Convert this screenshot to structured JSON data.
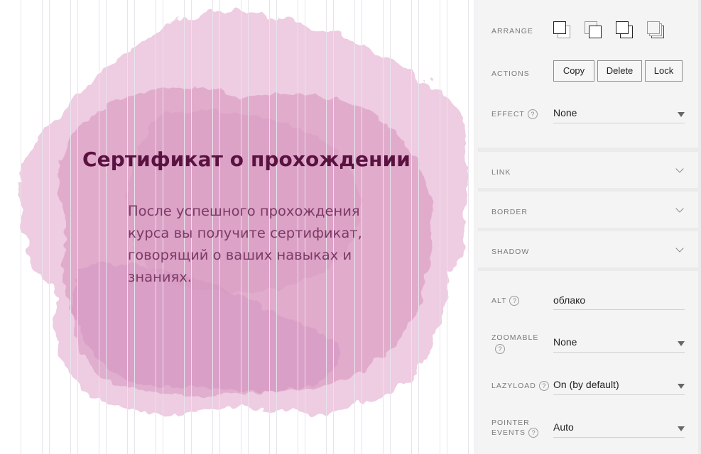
{
  "canvas": {
    "heading": "Сертификат о прохождении",
    "body_lines": [
      "После успешного прохождения",
      "курса вы получите сертификат,",
      "говорящий о ваших навыках и",
      "знаниях."
    ],
    "colors": {
      "blob": "#e2a6cc",
      "heading": "#5a1240",
      "body": "#7c3a65",
      "grid_line": "#e8e4ec"
    }
  },
  "panel": {
    "arrange": {
      "label": "ARRANGE",
      "icons": [
        "bring-to-front-icon",
        "bring-forward-icon",
        "send-backward-icon",
        "send-to-back-icon"
      ]
    },
    "actions": {
      "label": "ACTIONS",
      "buttons": [
        "Copy",
        "Delete",
        "Lock"
      ]
    },
    "effect": {
      "label": "EFFECT",
      "help": "?",
      "value": "None"
    },
    "link": {
      "label": "LINK"
    },
    "border": {
      "label": "BORDER"
    },
    "shadow": {
      "label": "SHADOW"
    },
    "alt": {
      "label": "ALT",
      "help": "?",
      "value": "облако"
    },
    "zoomable": {
      "label": "ZOOMABLE",
      "help": "?",
      "value": "None"
    },
    "lazyload": {
      "label": "LAZYLOAD",
      "help": "?",
      "value": "On (by default)"
    },
    "pointer_events": {
      "label_line1": "POINTER",
      "label_line2": "EVENTS",
      "help": "?",
      "value": "Auto"
    }
  }
}
